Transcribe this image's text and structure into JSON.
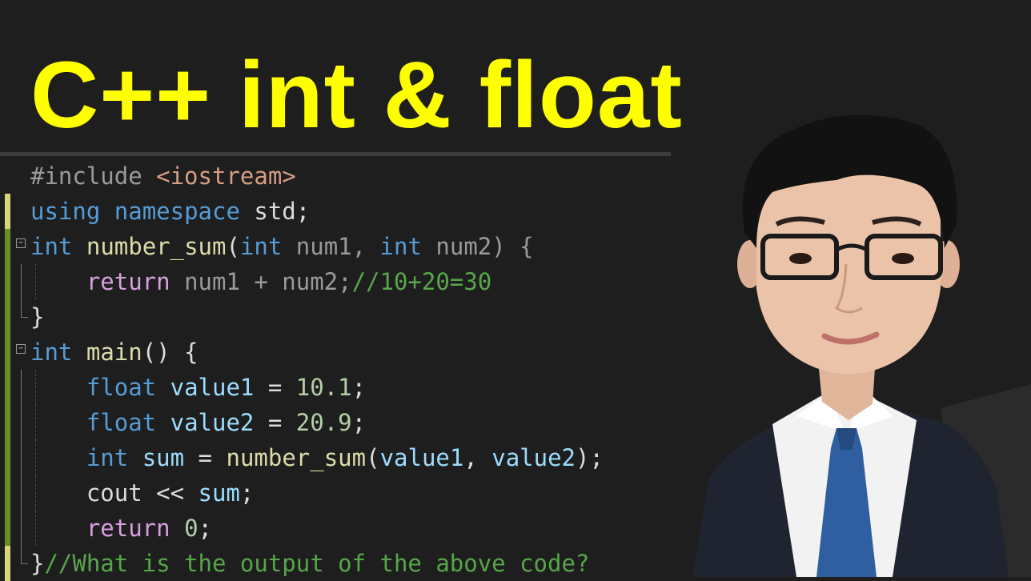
{
  "title": "C++ int & float",
  "code": {
    "l1": [
      "#include ",
      "<iostream>"
    ],
    "l2": [
      "using",
      " ",
      "namespace",
      " std;"
    ],
    "l3": [
      "int",
      " ",
      "number_sum",
      "(",
      "int",
      " num1, ",
      "int",
      " num2) {"
    ],
    "l4": [
      "    ",
      "return",
      " num1 + num2;",
      "//10+20=30"
    ],
    "l5": [
      "}"
    ],
    "l6": [
      "int",
      " ",
      "main",
      "() {"
    ],
    "l7": [
      "    ",
      "float",
      " ",
      "value1",
      " = ",
      "10.1",
      ";"
    ],
    "l8": [
      "    ",
      "float",
      " ",
      "value2",
      " = ",
      "20.9",
      ";"
    ],
    "l9": [
      "    ",
      "int",
      " ",
      "sum",
      " = ",
      "number_sum",
      "(",
      "value1",
      ", ",
      "value2",
      ");"
    ],
    "l10": [
      "    cout << ",
      "sum",
      ";"
    ],
    "l11": [
      "    ",
      "return",
      " ",
      "0",
      ";"
    ],
    "l12": [
      "}",
      "//What is the output of the above code?"
    ]
  },
  "icons": {
    "fold_minus": "−",
    "photo": "presenter-photo"
  },
  "colors": {
    "title": "#ffff00",
    "background": "#1e1e1e",
    "keyword": "#569cd6",
    "control": "#d8a0df",
    "function": "#dcdcaa",
    "variable": "#9cdcfe",
    "number": "#b5cea8",
    "comment": "#57a64a"
  }
}
